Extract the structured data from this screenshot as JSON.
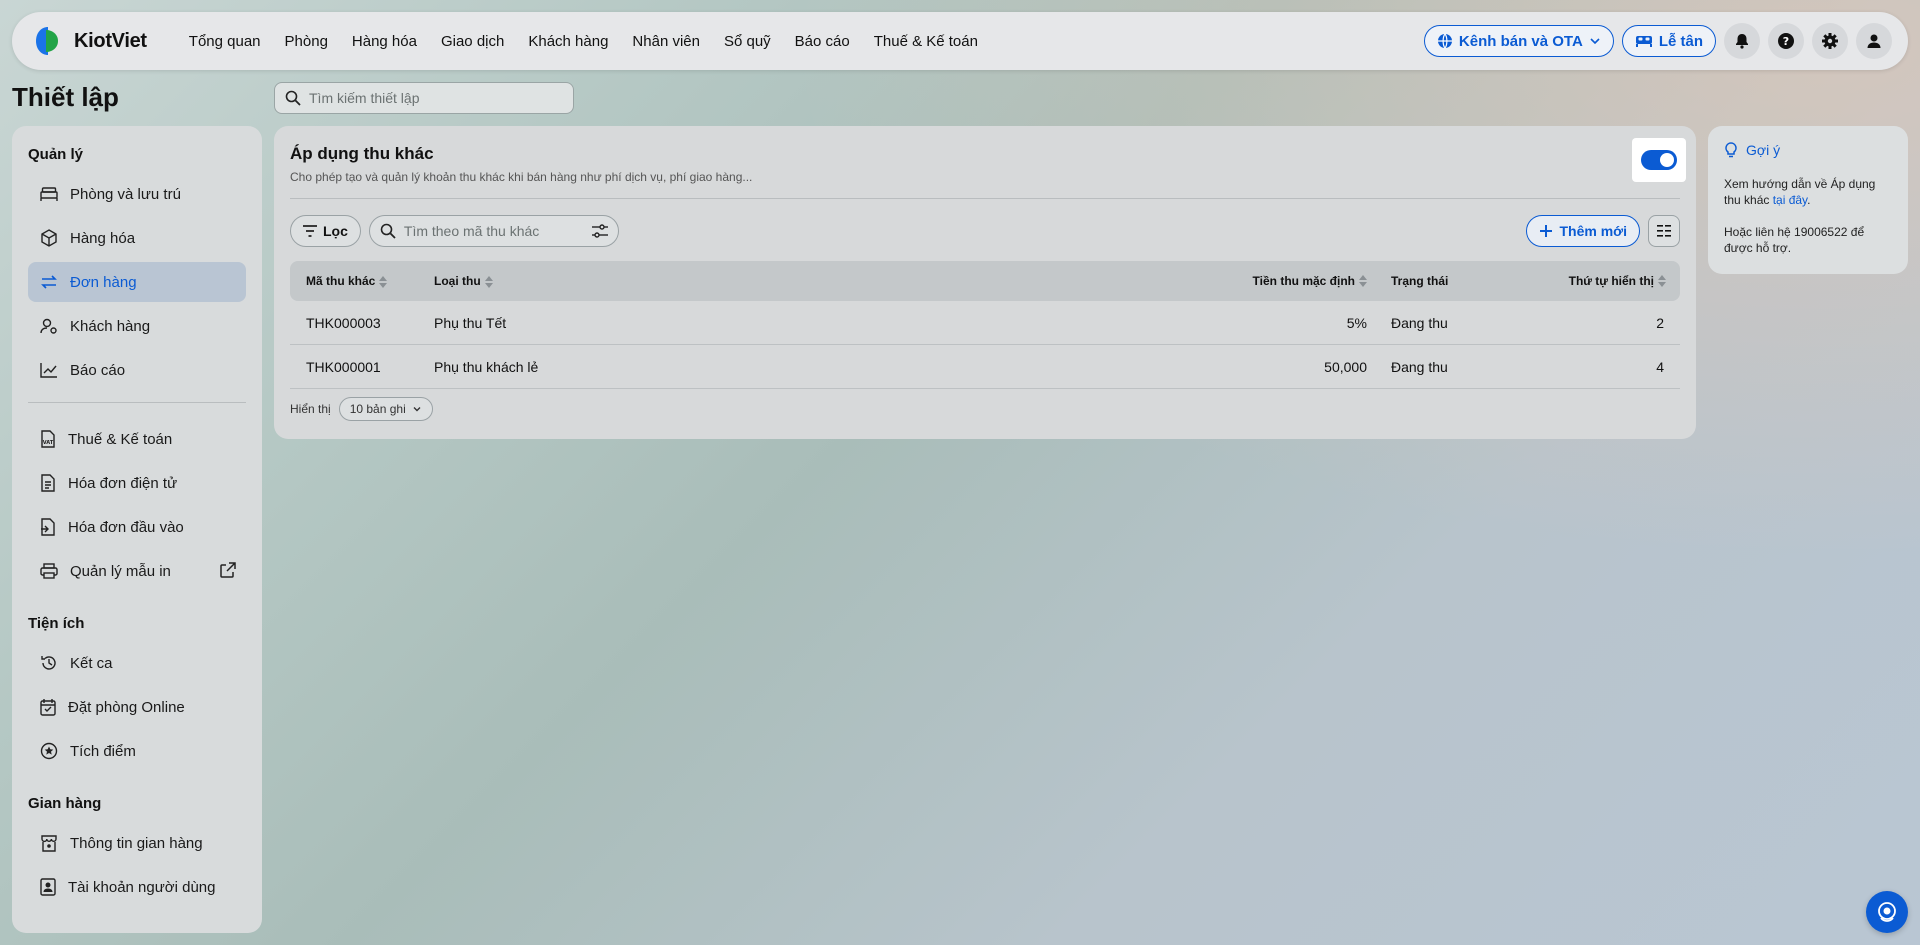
{
  "app": {
    "name": "KiotViet"
  },
  "nav": [
    "Tổng quan",
    "Phòng",
    "Hàng hóa",
    "Giao dịch",
    "Khách hàng",
    "Nhân viên",
    "Sổ quỹ",
    "Báo cáo",
    "Thuế & Kế toán"
  ],
  "topright": {
    "channel_label": "Kênh bán và OTA",
    "reception_label": "Lễ tân"
  },
  "page": {
    "title": "Thiết lập",
    "search_placeholder": "Tìm kiếm thiết lập"
  },
  "sidebar": {
    "sections": [
      {
        "title": "Quản lý",
        "items": [
          {
            "label": "Phòng và lưu trú",
            "icon": "bed-icon",
            "active": false
          },
          {
            "label": "Hàng hóa",
            "icon": "box-icon",
            "active": false
          },
          {
            "label": "Đơn hàng",
            "icon": "swap-icon",
            "active": true
          },
          {
            "label": "Khách hàng",
            "icon": "user-settings-icon",
            "active": false
          },
          {
            "label": "Báo cáo",
            "icon": "chart-icon",
            "active": false
          }
        ]
      },
      {
        "title": "",
        "items": [
          {
            "label": "Thuế & Kế toán",
            "icon": "vat-doc-icon",
            "active": false
          },
          {
            "label": "Hóa đơn điện tử",
            "icon": "document-icon",
            "active": false
          },
          {
            "label": "Hóa đơn đầu vào",
            "icon": "document-import-icon",
            "active": false
          },
          {
            "label": "Quản lý mẫu in",
            "icon": "printer-icon",
            "active": false,
            "external": true
          }
        ]
      },
      {
        "title": "Tiện ích",
        "items": [
          {
            "label": "Kết ca",
            "icon": "history-icon",
            "active": false
          },
          {
            "label": "Đặt phòng Online",
            "icon": "calendar-check-icon",
            "active": false
          },
          {
            "label": "Tích điểm",
            "icon": "star-circle-icon",
            "active": false
          }
        ]
      },
      {
        "title": "Gian hàng",
        "items": [
          {
            "label": "Thông tin gian hàng",
            "icon": "store-icon",
            "active": false
          },
          {
            "label": "Tài khoản người dùng",
            "icon": "user-badge-icon",
            "active": false
          }
        ]
      }
    ]
  },
  "main": {
    "title": "Áp dụng thu khác",
    "description": "Cho phép tạo và quản lý khoản thu khác khi bán hàng như phí dịch vụ, phí giao hàng...",
    "toggle_on": true,
    "filter_label": "Lọc",
    "search_placeholder": "Tìm theo mã thu khác",
    "add_label": "Thêm mới",
    "table": {
      "headers": [
        "Mã thu khác",
        "Loại thu",
        "Tiền thu mặc định",
        "Trạng thái",
        "Thứ tự hiển thị"
      ],
      "rows": [
        [
          "THK000003",
          "Phụ thu Tết",
          "5%",
          "Đang thu",
          "2"
        ],
        [
          "THK000001",
          "Phụ thu khách lẻ",
          "50,000",
          "Đang thu",
          "4"
        ]
      ]
    },
    "pager": {
      "label": "Hiển thị",
      "page_size": "10 bản ghi"
    }
  },
  "hint": {
    "title": "Gợi ý",
    "text": "Xem hướng dẫn về Áp dụng thu khác ",
    "link": "tại đây",
    "text_end": ".",
    "contact": "Hoặc liên hệ 19006522 để được hỗ trợ."
  },
  "colors": {
    "accent": "#0b5bd3",
    "logo_blue": "#1a73e8",
    "logo_green": "#22a447"
  }
}
